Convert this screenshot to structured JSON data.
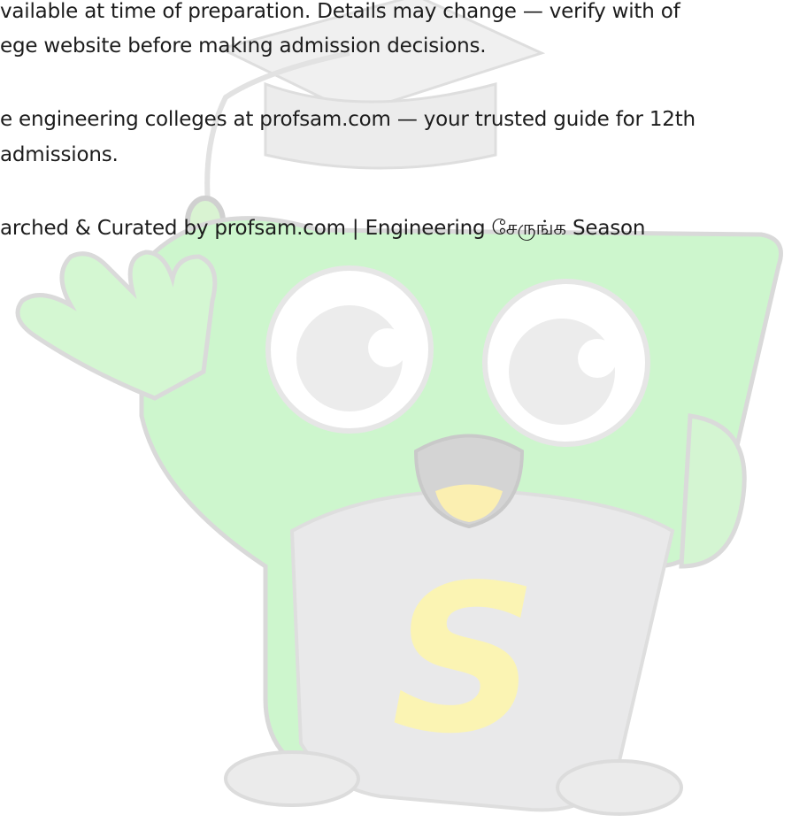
{
  "paragraphs": [
    {
      "lines": [
        "vailable at time of preparation. Details may change — verify with of",
        "ege website before making admission decisions."
      ]
    },
    {
      "lines": [
        "e engineering colleges at profsam.com — your trusted guide for 12th",
        "admissions."
      ]
    },
    {
      "lines": [
        "arched & Curated by profsam.com | Engineering சேருங்க Season"
      ]
    }
  ],
  "mascot": {
    "badge_letter": "S",
    "colors": {
      "body_green": "#c9f5c9",
      "body_outline": "#d6d6d6",
      "shadow_gray": "#e9e9ea",
      "letter_yellow": "#fbf4b3",
      "mouth_yellow": "#fbefb1",
      "mouth_gray": "#c4c4c4",
      "cap_gray": "#ececec"
    }
  }
}
